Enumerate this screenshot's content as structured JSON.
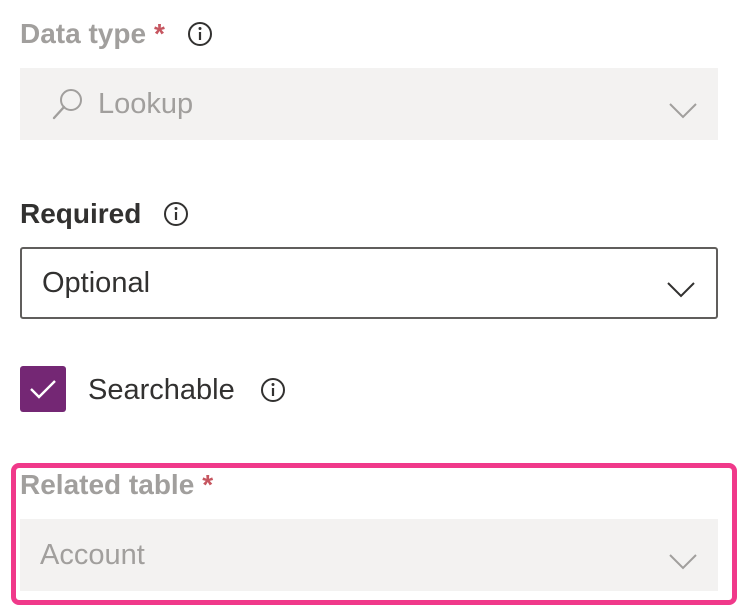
{
  "data_type": {
    "label": "Data type",
    "required_marker": "*",
    "value": "Lookup",
    "disabled": true
  },
  "required": {
    "label": "Required",
    "value": "Optional"
  },
  "searchable": {
    "label": "Searchable",
    "checked": true
  },
  "related_table": {
    "label": "Related table",
    "required_marker": "*",
    "value": "Account",
    "disabled": true
  },
  "colors": {
    "accent_checkbox": "#742774",
    "highlight_border": "#f0398a",
    "required_marker": "#a4262c",
    "disabled_text": "#a19f9d",
    "disabled_fill": "#f3f2f1"
  },
  "icons": {
    "info": "info-icon",
    "search": "search-icon",
    "chevron": "chevron-down-icon",
    "check": "checkmark-icon"
  }
}
